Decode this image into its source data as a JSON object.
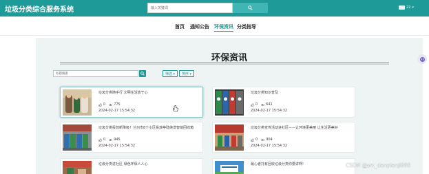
{
  "app": {
    "title": "垃圾分类综合服务系统"
  },
  "search": {
    "placeholder": "输入关键词"
  },
  "user": {
    "name": "22",
    "caret": "▾"
  },
  "nav": [
    {
      "label": "首页"
    },
    {
      "label": "通知公告"
    },
    {
      "label": "环保资讯",
      "active": true
    },
    {
      "label": "分类指导"
    }
  ],
  "page": {
    "title": "环保资讯"
  },
  "filter": {
    "placeholder": "标题搜索",
    "dropdown_1": "筛选 ▾",
    "dropdown_2": "排序 ▾"
  },
  "cards": [
    {
      "title": "垃圾分类随手行 文明生活放于心",
      "likes": "0",
      "views": "775",
      "date": "2024-02-17 15:54:32"
    },
    {
      "title": "垃圾分类知识普及",
      "likes": "0",
      "views": "641",
      "date": "2024-02-17 15:54:32"
    },
    {
      "title": "垃圾分类投放新降级！兰州市8个小区投放亭陆续增智能回收箱",
      "likes": "0",
      "views": "945",
      "date": "2024-02-17 15:54:32"
    },
    {
      "title": "垃圾分类宣传活动进社区——让环境更美丽 让生活更美好",
      "likes": "0",
      "views": "904",
      "date": "2024-02-17 15:54:32"
    },
    {
      "title": "垃圾分类进社区 绿色环保人人心",
      "likes": "",
      "views": "",
      "date": ""
    },
    {
      "title": "最心者托有回收垃圾分类你要讲啊!",
      "likes": "",
      "views": "",
      "date": ""
    }
  ],
  "watermark": "CSDN @wx_danpianji889",
  "colors": {
    "accent": "#1e9a98",
    "topbar": "#1e9a98",
    "panel_bg": "#eef4f4"
  },
  "icons": {
    "search": "search-icon",
    "like": "thumb-up-icon",
    "view": "eye-icon"
  }
}
